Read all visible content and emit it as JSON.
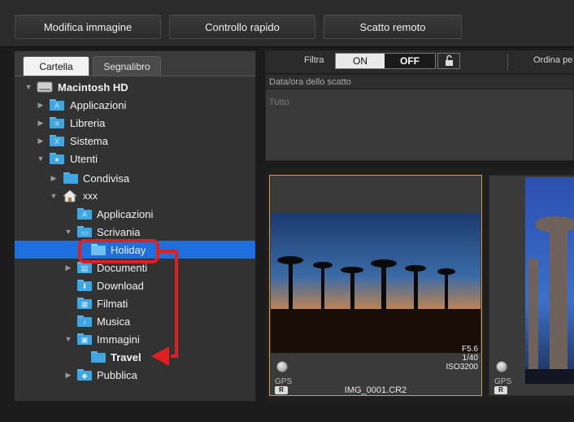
{
  "toolbar": {
    "edit_image": "Modifica immagine",
    "quick_check": "Controllo rapido",
    "remote_shooting": "Scatto remoto"
  },
  "left_panel": {
    "tabs": [
      {
        "label": "Cartella",
        "active": true
      },
      {
        "label": "Segnalibro",
        "active": false
      }
    ],
    "tree": [
      {
        "label": "Macintosh HD",
        "icon": "hard-drive-icon",
        "expanded": true
      },
      {
        "label": "Applicazioni",
        "icon": "applications-folder-icon"
      },
      {
        "label": "Libreria",
        "icon": "library-folder-icon"
      },
      {
        "label": "Sistema",
        "icon": "system-folder-icon"
      },
      {
        "label": "Utenti",
        "icon": "users-folder-icon",
        "expanded": true
      },
      {
        "label": "Condivisa",
        "icon": "folder-icon"
      },
      {
        "label": "xxx",
        "icon": "home-icon",
        "expanded": true
      },
      {
        "label": "Applicazioni",
        "icon": "applications-folder-icon"
      },
      {
        "label": "Scrivania",
        "icon": "desktop-folder-icon",
        "expanded": true
      },
      {
        "label": "Holiday",
        "icon": "folder-icon",
        "selected": true
      },
      {
        "label": "Documenti",
        "icon": "documents-folder-icon"
      },
      {
        "label": "Download",
        "icon": "downloads-folder-icon"
      },
      {
        "label": "Filmati",
        "icon": "movies-folder-icon"
      },
      {
        "label": "Musica",
        "icon": "music-folder-icon"
      },
      {
        "label": "Immagini",
        "icon": "pictures-folder-icon",
        "expanded": true
      },
      {
        "label": "Travel",
        "icon": "folder-icon"
      },
      {
        "label": "Pubblica",
        "icon": "public-folder-icon"
      }
    ]
  },
  "filter": {
    "label": "Filtra",
    "on": "ON",
    "off": "OFF",
    "state": "OFF",
    "sort_label": "Ordina pe"
  },
  "date_filter": {
    "header": "Data/ora dello scatto",
    "value": "Tutto"
  },
  "thumbnails": [
    {
      "filename": "IMG_0001.CR2",
      "aperture": "F5.6",
      "shutter": "1/40",
      "iso": "ISO3200",
      "gps": "GPS",
      "badge": "R",
      "selected": true
    },
    {
      "gps": "GPS",
      "badge": "R",
      "selected": false
    }
  ],
  "annotation": {
    "arrow_color": "#e01f1f",
    "accent_selection": "#1d6fe0",
    "thumb_border": "#d79a3f"
  }
}
